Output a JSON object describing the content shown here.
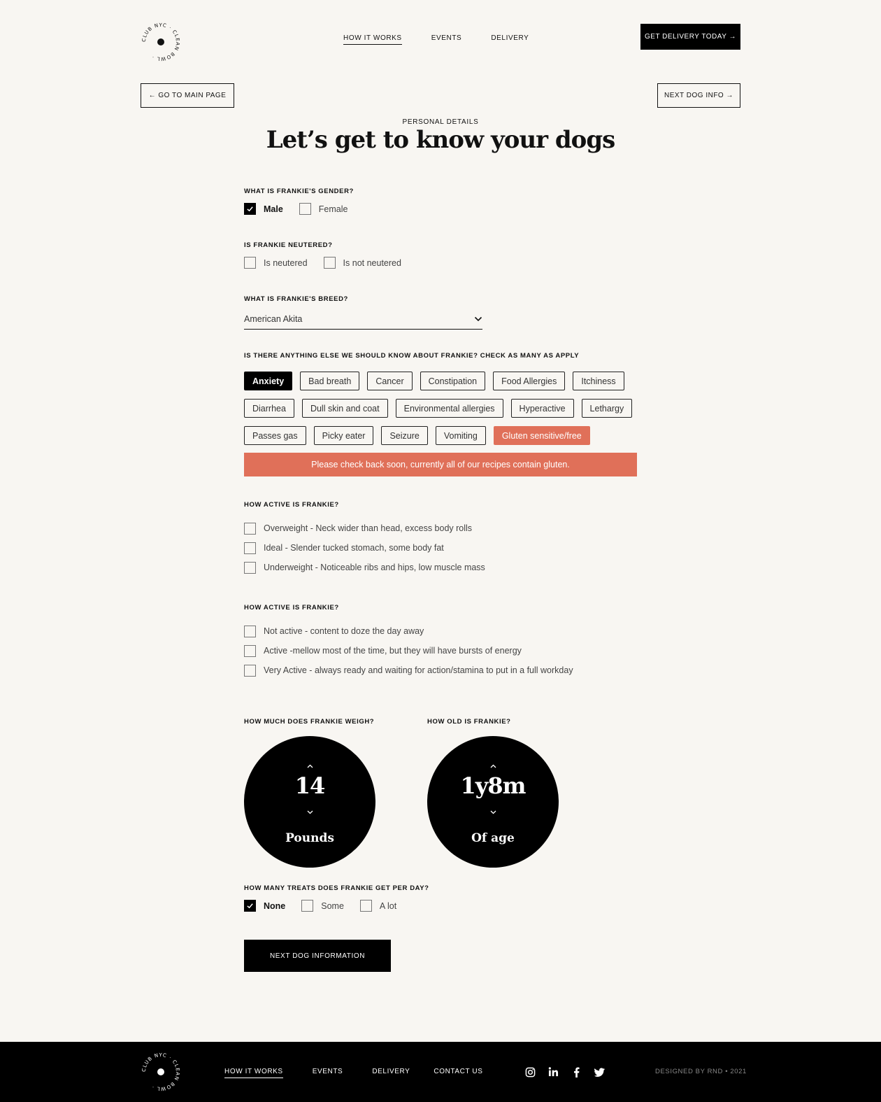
{
  "header": {
    "logo_text": "CLUB NYC CLEAN BOWL",
    "nav": [
      "HOW IT WORKS",
      "EVENTS",
      "DELIVERY"
    ],
    "cta": "GET DELIVERY TODAY →"
  },
  "subnav": {
    "back": "←  GO TO MAIN PAGE",
    "next": "NEXT DOG INFO →"
  },
  "eyebrow": "PERSONAL DETAILS",
  "title": "Let’s get to know your dogs",
  "gender": {
    "label": "WHAT IS FRANKIE'S GENDER?",
    "options": [
      {
        "text": "Male",
        "checked": true
      },
      {
        "text": "Female",
        "checked": false
      }
    ]
  },
  "neutered": {
    "label": "IS FRANKIE NEUTERED?",
    "options": [
      {
        "text": "Is neutered",
        "checked": false
      },
      {
        "text": "Is not neutered",
        "checked": false
      }
    ]
  },
  "breed": {
    "label": "WHAT IS FRANKIE'S BREED?",
    "value": "American Akita"
  },
  "conditions": {
    "label": "IS THERE ANYTHING ELSE WE SHOULD KNOW ABOUT FRANKIE? CHECK AS MANY AS APPLY",
    "rows": [
      [
        "Anxiety",
        "Bad breath",
        "Cancer",
        "Constipation",
        "Food Allergies",
        "Itchiness"
      ],
      [
        "Diarrhea",
        "Dull skin and coat",
        "Environmental allergies",
        "Hyperactive",
        "Lethargy"
      ],
      [
        "Passes gas",
        "Picky eater",
        "Seizure",
        "Vomiting",
        "Gluten sensitive/free"
      ]
    ],
    "selected": "Anxiety",
    "warning_selected": "Gluten sensitive/free",
    "alert": "Please check back soon, currently all of our recipes contain gluten."
  },
  "body_type": {
    "label": "HOW ACTIVE IS FRANKIE?",
    "options": [
      "Overweight - Neck wider than head, excess body rolls",
      "Ideal - Slender tucked stomach, some body fat",
      "Underweight - Noticeable ribs and hips, low muscle mass"
    ]
  },
  "activity": {
    "label": "HOW ACTIVE IS FRANKIE?",
    "options": [
      "Not active - content to doze the day away",
      "Active -mellow most of the time, but they will have bursts of energy",
      "Very Active - always ready and waiting for action/stamina to put in a full workday"
    ]
  },
  "weight": {
    "label": "HOW MUCH DOES FRANKIE WEIGH?",
    "value": "14",
    "unit": "Pounds"
  },
  "age": {
    "label": "HOW OLD IS FRANKIE?",
    "value": "1y8m",
    "unit": "Of age"
  },
  "treats": {
    "label": "HOW MANY TREATS DOES FRANKIE GET PER DAY?",
    "options": [
      {
        "text": "None",
        "checked": true
      },
      {
        "text": "Some",
        "checked": false
      },
      {
        "text": "A lot",
        "checked": false
      }
    ]
  },
  "submit": "NEXT DOG INFORMATION",
  "footer": {
    "nav": [
      "HOW IT WORKS",
      "EVENTS",
      "DELIVERY",
      "CONTACT US"
    ],
    "social": [
      "instagram-icon",
      "linkedin-icon",
      "facebook-icon",
      "twitter-icon"
    ],
    "credit": "DESIGNED BY RND  •  2021"
  },
  "colors": {
    "background": "#f8f6f2",
    "accent": "#e07059",
    "dark": "#000000"
  }
}
